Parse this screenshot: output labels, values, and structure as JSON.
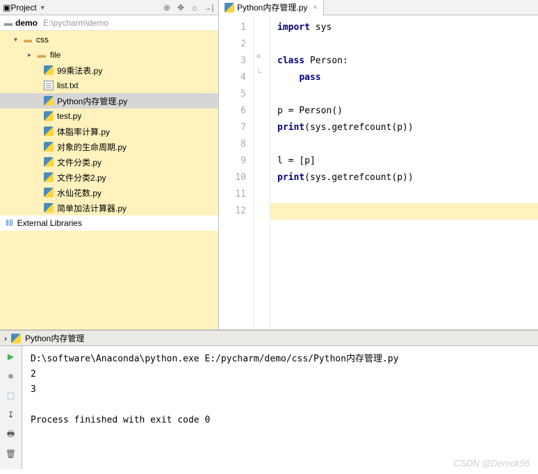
{
  "project_panel": {
    "title": "Project",
    "breadcrumb_name": "demo",
    "breadcrumb_path": "E:\\pycharm\\demo"
  },
  "tree": {
    "css_folder": "css",
    "file_folder": "file",
    "files": [
      "99乘法表.py",
      "list.txt",
      "Python内存管理.py",
      "test.py",
      "体脂率计算.py",
      "对象的生命周期.py",
      "文件分类.py",
      "文件分类2.py",
      "水仙花数.py",
      "简单加法计算器.py"
    ],
    "external_libraries": "External Libraries"
  },
  "editor": {
    "tab_title": "Python内存管理.py",
    "lines": {
      "l1a": "import",
      "l1b": " sys",
      "l3a": "class",
      "l3b": " Person:",
      "l4a": "pass",
      "l6": "p = Person()",
      "l7a": "print",
      "l7b": "(sys.getrefcount(p))",
      "l9": "l = [p]",
      "l10a": "print",
      "l10b": "(sys.getrefcount(p))"
    },
    "line_numbers": [
      "1",
      "2",
      "3",
      "4",
      "5",
      "6",
      "7",
      "8",
      "9",
      "10",
      "11",
      "12"
    ]
  },
  "run": {
    "title": "Python内存管理",
    "command": "D:\\software\\Anaconda\\python.exe E:/pycharm/demo/css/Python内存管理.py",
    "out1": "2",
    "out2": "3",
    "exit": "Process finished with exit code 0"
  },
  "watermark": "CSDN @Derrick56"
}
